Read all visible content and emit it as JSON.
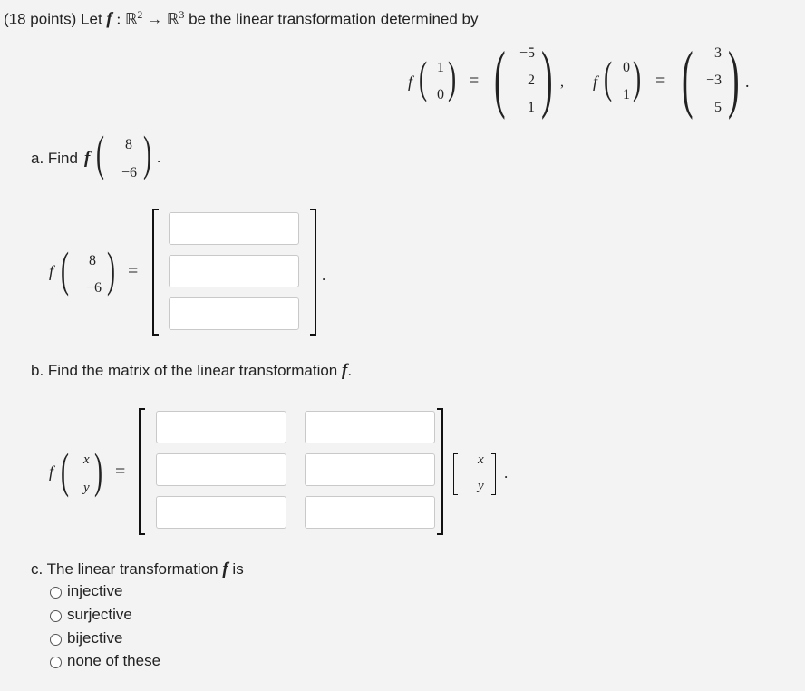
{
  "header": {
    "points": "(18 points) Let",
    "f": "f",
    "colon": ":",
    "domain": "ℝ",
    "domain_exp": "2",
    "arrow": "→",
    "codomain": "ℝ",
    "codomain_exp": "3",
    "rest": "be the linear transformation determined by"
  },
  "given": {
    "e1": {
      "input": [
        "1",
        "0"
      ],
      "output": [
        "−5",
        "2",
        "1"
      ]
    },
    "e2": {
      "input": [
        "0",
        "1"
      ],
      "output": [
        "3",
        "−3",
        "5"
      ]
    },
    "comma": ",",
    "period": "."
  },
  "part_a": {
    "label": "a. Find",
    "vector": [
      "8",
      "−6"
    ],
    "answer_inputs": [
      "",
      "",
      ""
    ]
  },
  "part_b": {
    "label": "b. Find the matrix of the linear transformation",
    "vars": [
      "x",
      "y"
    ],
    "matrix_inputs": [
      [
        "",
        ""
      ],
      [
        "",
        ""
      ],
      [
        "",
        ""
      ]
    ]
  },
  "part_c": {
    "label_pre": "c. The linear transformation",
    "label_post": "is",
    "options": [
      "injective",
      "surjective",
      "bijective",
      "none of these"
    ]
  },
  "symbols": {
    "f": "f",
    "eq": "=",
    "dot": ".",
    "lparen": "(",
    "rparen": ")"
  }
}
